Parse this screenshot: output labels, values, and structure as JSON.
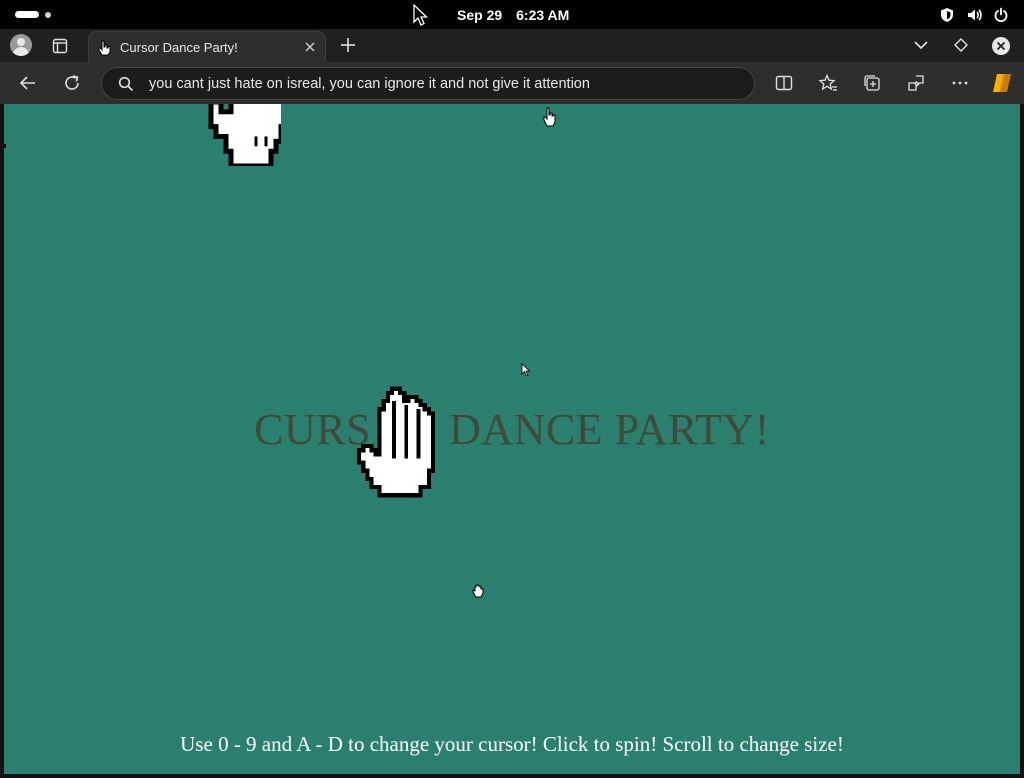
{
  "os": {
    "date": "Sep 29",
    "time": "6:23 AM",
    "tray_icons": [
      "shield-icon",
      "volume-icon",
      "power-icon"
    ]
  },
  "browser": {
    "tab": {
      "title": "Cursor Dance Party!",
      "favicon": "hand-cursor-icon"
    },
    "address_bar": {
      "text": "you cant just hate on isreal, you can ignore it and not give it attention"
    },
    "toolbar_icons": [
      "back-icon",
      "reload-icon",
      "split-screen-icon",
      "favorites-icon",
      "collections-icon",
      "extensions-icon",
      "more-icon",
      "copilot-icon"
    ]
  },
  "page": {
    "title": "CURSOR DANCE PARTY!",
    "title_visible_left": "CURS",
    "title_visible_right": "DANCE PARTY!",
    "hint": "Use 0 - 9 and A - D to change your cursor! Click to spin! Scroll to change size!",
    "background_color": "#2b7f6f",
    "title_color": "#3f4a3a"
  }
}
